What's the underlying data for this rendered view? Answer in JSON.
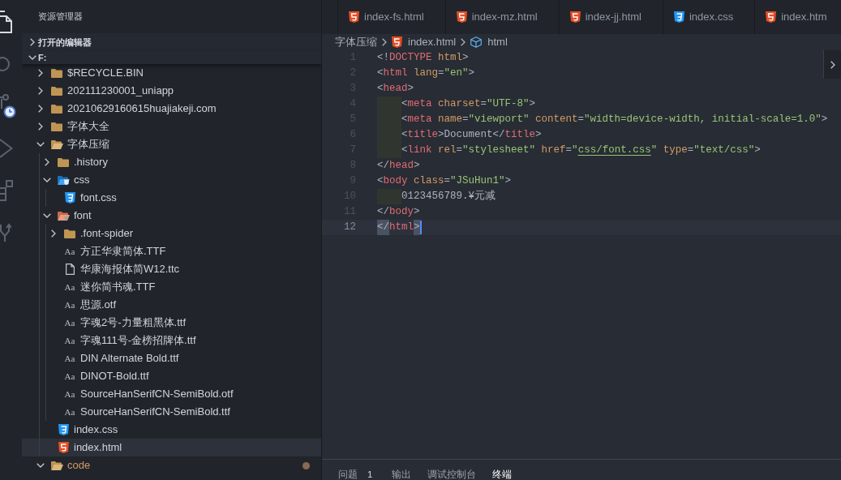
{
  "activity_bar": [
    {
      "kind": "files",
      "selected": true
    },
    {
      "kind": "search",
      "selected": false
    },
    {
      "kind": "branch-clock",
      "selected": false
    },
    {
      "kind": "run",
      "selected": false
    },
    {
      "kind": "extensions",
      "selected": false
    },
    {
      "kind": "fork",
      "selected": false
    }
  ],
  "sidebar": {
    "title": "资源管理器",
    "sections": [
      {
        "label": "打开的编辑器",
        "expanded": false
      },
      {
        "label": "F:",
        "expanded": true,
        "children": [
          {
            "name": "$RECYCLE.BIN",
            "kind": "folder",
            "expanded": false,
            "selected": false,
            "modified": false
          },
          {
            "name": "202111230001_uniapp",
            "kind": "folder",
            "expanded": false,
            "selected": false,
            "modified": false
          },
          {
            "name": "20210629160615huajiakeji.com",
            "kind": "folder",
            "expanded": false,
            "selected": false,
            "modified": false
          },
          {
            "name": "字体大全",
            "kind": "folder",
            "expanded": false,
            "selected": false,
            "modified": false
          },
          {
            "name": "字体压缩",
            "kind": "folder",
            "expanded": true,
            "selected": false,
            "modified": false,
            "children": [
              {
                "name": ".history",
                "kind": "folder",
                "expanded": false,
                "selected": false,
                "modified": false
              },
              {
                "name": "css",
                "kind": "css-folder",
                "expanded": true,
                "selected": false,
                "modified": false,
                "children": [
                  {
                    "name": "font.css",
                    "kind": "css",
                    "selected": false,
                    "modified": false
                  }
                ]
              },
              {
                "name": "font",
                "kind": "font-folder",
                "expanded": true,
                "selected": false,
                "modified": false,
                "children": [
                  {
                    "name": ".font-spider",
                    "kind": "folder",
                    "expanded": false,
                    "selected": false,
                    "modified": false
                  },
                  {
                    "name": "方正华隶简体.TTF",
                    "kind": "font",
                    "glyph": "Aa",
                    "selected": false,
                    "modified": false
                  },
                  {
                    "name": "华康海报体简W12.ttc",
                    "kind": "file",
                    "selected": false,
                    "modified": false
                  },
                  {
                    "name": "迷你简书魂.TTF",
                    "kind": "font",
                    "glyph": "Aa",
                    "selected": false,
                    "modified": false
                  },
                  {
                    "name": "思源.otf",
                    "kind": "font",
                    "glyph": "Aa",
                    "selected": false,
                    "modified": false
                  },
                  {
                    "name": "字魂2号-力量粗黑体.ttf",
                    "kind": "font",
                    "glyph": "Aa",
                    "selected": false,
                    "modified": false
                  },
                  {
                    "name": "字魂111号-金榜招牌体.ttf",
                    "kind": "font",
                    "glyph": "Aa",
                    "selected": false,
                    "modified": false
                  },
                  {
                    "name": "DIN Alternate Bold.ttf",
                    "kind": "font",
                    "glyph": "Aa",
                    "selected": false,
                    "modified": false
                  },
                  {
                    "name": "DINOT-Bold.ttf",
                    "kind": "font",
                    "glyph": "Aa",
                    "selected": false,
                    "modified": false
                  },
                  {
                    "name": "SourceHanSerifCN-SemiBold.otf",
                    "kind": "font",
                    "glyph": "Aa",
                    "selected": false,
                    "modified": false
                  },
                  {
                    "name": "SourceHanSerifCN-SemiBold.ttf",
                    "kind": "font",
                    "glyph": "Aa",
                    "selected": false,
                    "modified": false
                  }
                ]
              },
              {
                "name": "index.css",
                "kind": "css",
                "selected": false,
                "modified": false
              },
              {
                "name": "index.html",
                "kind": "html",
                "selected": true,
                "modified": false
              }
            ]
          },
          {
            "name": "code",
            "kind": "folder",
            "expanded": true,
            "selected": false,
            "modified": true
          }
        ]
      }
    ]
  },
  "tabs": [
    {
      "label": "index-fs.html",
      "kind": "html",
      "selected": false
    },
    {
      "label": "index-mz.html",
      "kind": "html",
      "selected": false
    },
    {
      "label": "index-jj.html",
      "kind": "html",
      "selected": false
    },
    {
      "label": "index.css",
      "kind": "css",
      "selected": false
    },
    {
      "label": "index.htm",
      "kind": "html",
      "selected": false
    }
  ],
  "breadcrumb": [
    {
      "label": "字体压缩",
      "kind": "folder"
    },
    {
      "label": "index.html",
      "kind": "html"
    },
    {
      "label": "html",
      "kind": "element"
    }
  ],
  "code": {
    "lines": [
      {
        "number": "1",
        "indented": false,
        "current": false,
        "tokens": [
          {
            "text": "<!",
            "kind": "p"
          },
          {
            "text": "DOCTYPE",
            "kind": "tag"
          },
          {
            "text": " html",
            "kind": "attr"
          },
          {
            "text": ">",
            "kind": "p"
          }
        ]
      },
      {
        "number": "2",
        "indented": false,
        "current": false,
        "tokens": [
          {
            "text": "<",
            "kind": "p"
          },
          {
            "text": "html",
            "kind": "tag"
          },
          {
            "text": " lang",
            "kind": "attr"
          },
          {
            "text": "=",
            "kind": "p"
          },
          {
            "text": "\"en\"",
            "kind": "str"
          },
          {
            "text": ">",
            "kind": "p"
          }
        ]
      },
      {
        "number": "3",
        "indented": false,
        "current": false,
        "tokens": [
          {
            "text": "<",
            "kind": "p"
          },
          {
            "text": "head",
            "kind": "tag"
          },
          {
            "text": ">",
            "kind": "p"
          }
        ]
      },
      {
        "number": "4",
        "indented": true,
        "current": false,
        "tokens": [
          {
            "text": "<",
            "kind": "p"
          },
          {
            "text": "meta",
            "kind": "tag"
          },
          {
            "text": " charset",
            "kind": "attr"
          },
          {
            "text": "=",
            "kind": "p"
          },
          {
            "text": "\"UTF-8\"",
            "kind": "str"
          },
          {
            "text": ">",
            "kind": "p"
          }
        ]
      },
      {
        "number": "5",
        "indented": true,
        "current": false,
        "tokens": [
          {
            "text": "<",
            "kind": "p"
          },
          {
            "text": "meta",
            "kind": "tag"
          },
          {
            "text": " name",
            "kind": "attr"
          },
          {
            "text": "=",
            "kind": "p"
          },
          {
            "text": "\"viewport\"",
            "kind": "str"
          },
          {
            "text": " content",
            "kind": "attr"
          },
          {
            "text": "=",
            "kind": "p"
          },
          {
            "text": "\"width=device-width, initial-scale=1.0\"",
            "kind": "str"
          },
          {
            "text": ">",
            "kind": "p"
          }
        ]
      },
      {
        "number": "6",
        "indented": true,
        "current": false,
        "tokens": [
          {
            "text": "<",
            "kind": "p"
          },
          {
            "text": "title",
            "kind": "tag"
          },
          {
            "text": ">",
            "kind": "p"
          },
          {
            "text": "Document",
            "kind": "text"
          },
          {
            "text": "</",
            "kind": "p"
          },
          {
            "text": "title",
            "kind": "tag"
          },
          {
            "text": ">",
            "kind": "p"
          }
        ]
      },
      {
        "number": "7",
        "indented": true,
        "current": false,
        "tokens": [
          {
            "text": "<",
            "kind": "p"
          },
          {
            "text": "link",
            "kind": "tag"
          },
          {
            "text": " rel",
            "kind": "attr"
          },
          {
            "text": "=",
            "kind": "p"
          },
          {
            "text": "\"stylesheet\"",
            "kind": "str"
          },
          {
            "text": " href",
            "kind": "attr"
          },
          {
            "text": "=",
            "kind": "p"
          },
          {
            "text": "\"",
            "kind": "str"
          },
          {
            "text": "css/font.css",
            "kind": "link"
          },
          {
            "text": "\"",
            "kind": "str"
          },
          {
            "text": " type",
            "kind": "attr"
          },
          {
            "text": "=",
            "kind": "p"
          },
          {
            "text": "\"text/css\"",
            "kind": "str"
          },
          {
            "text": ">",
            "kind": "p"
          }
        ]
      },
      {
        "number": "8",
        "indented": false,
        "current": false,
        "tokens": [
          {
            "text": "</",
            "kind": "p"
          },
          {
            "text": "head",
            "kind": "tag"
          },
          {
            "text": ">",
            "kind": "p"
          }
        ]
      },
      {
        "number": "9",
        "indented": false,
        "current": false,
        "tokens": [
          {
            "text": "<",
            "kind": "p"
          },
          {
            "text": "body",
            "kind": "tag"
          },
          {
            "text": " class",
            "kind": "attr"
          },
          {
            "text": "=",
            "kind": "p"
          },
          {
            "text": "\"JSuHun1\"",
            "kind": "str"
          },
          {
            "text": ">",
            "kind": "p"
          }
        ]
      },
      {
        "number": "10",
        "indented": true,
        "current": false,
        "tokens": [
          {
            "text": "0123456789.¥元减",
            "kind": "text"
          }
        ]
      },
      {
        "number": "11",
        "indented": false,
        "current": false,
        "tokens": [
          {
            "text": "</",
            "kind": "p"
          },
          {
            "text": "body",
            "kind": "tag"
          },
          {
            "text": ">",
            "kind": "p"
          }
        ]
      },
      {
        "number": "12",
        "indented": false,
        "current": true,
        "tokens": [
          {
            "text": "</",
            "kind": "pm"
          },
          {
            "text": "html",
            "kind": "tag"
          },
          {
            "text": ">",
            "kind": "pm"
          }
        ]
      }
    ]
  },
  "panel": {
    "tabs": [
      {
        "label": "问题",
        "badge": "1",
        "selected": false
      },
      {
        "label": "输出",
        "selected": false
      },
      {
        "label": "调试控制台",
        "selected": false
      },
      {
        "label": "终端",
        "selected": true
      }
    ]
  }
}
